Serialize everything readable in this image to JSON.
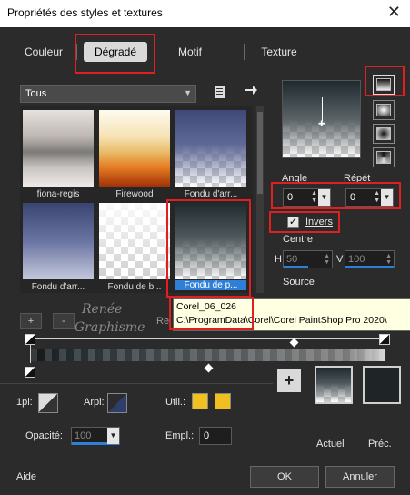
{
  "window": {
    "title": "Propriétés des styles et textures",
    "close_glyph": "✕"
  },
  "tabs": [
    {
      "label": "Couleur"
    },
    {
      "label": "Dégradé"
    },
    {
      "label": "Motif"
    },
    {
      "label": "Texture"
    }
  ],
  "library": {
    "category": "Tous",
    "swatches": [
      {
        "name": "fiona-regis"
      },
      {
        "name": "Firewood"
      },
      {
        "name": "Fondu d'arr..."
      },
      {
        "name": "Fondu d'arr..."
      },
      {
        "name": "Fondu de b..."
      },
      {
        "name": "Fondu de p..."
      }
    ],
    "add_label": "+",
    "remove_label": "-",
    "reset_label": "Re"
  },
  "tooltip": {
    "line1": "Corel_06_026",
    "line2": "C:\\ProgramData\\Corel\\Corel PaintShop Pro 2020\\"
  },
  "settings": {
    "angle_label": "Angle",
    "angle_value": "0",
    "repeat_label": "Répét",
    "repeat_value": "0",
    "invert_label": "Invers",
    "invert_checked": "✓",
    "center_label": "Centre",
    "h_label": "H",
    "h_value": "50",
    "v_label": "V",
    "v_value": "100",
    "source_label": "Source"
  },
  "watermark": {
    "line1": "Renée",
    "line2": "Graphisme"
  },
  "bottom": {
    "pl_label": "1pl:",
    "arpl_label": "Arpl:",
    "util_label": "Util.:",
    "opacity_label": "Opacité:",
    "opacity_value": "100",
    "empl_label": "Empl.:",
    "empl_value": "0",
    "current_label": "Actuel",
    "previous_label": "Préc.",
    "add_glyph": "+"
  },
  "footer": {
    "help": "Aide",
    "ok": "OK",
    "cancel": "Annuler"
  },
  "colors": {
    "accent": "#2f7fd6",
    "highlight": "#e02020",
    "yellow": "#f0c020"
  }
}
